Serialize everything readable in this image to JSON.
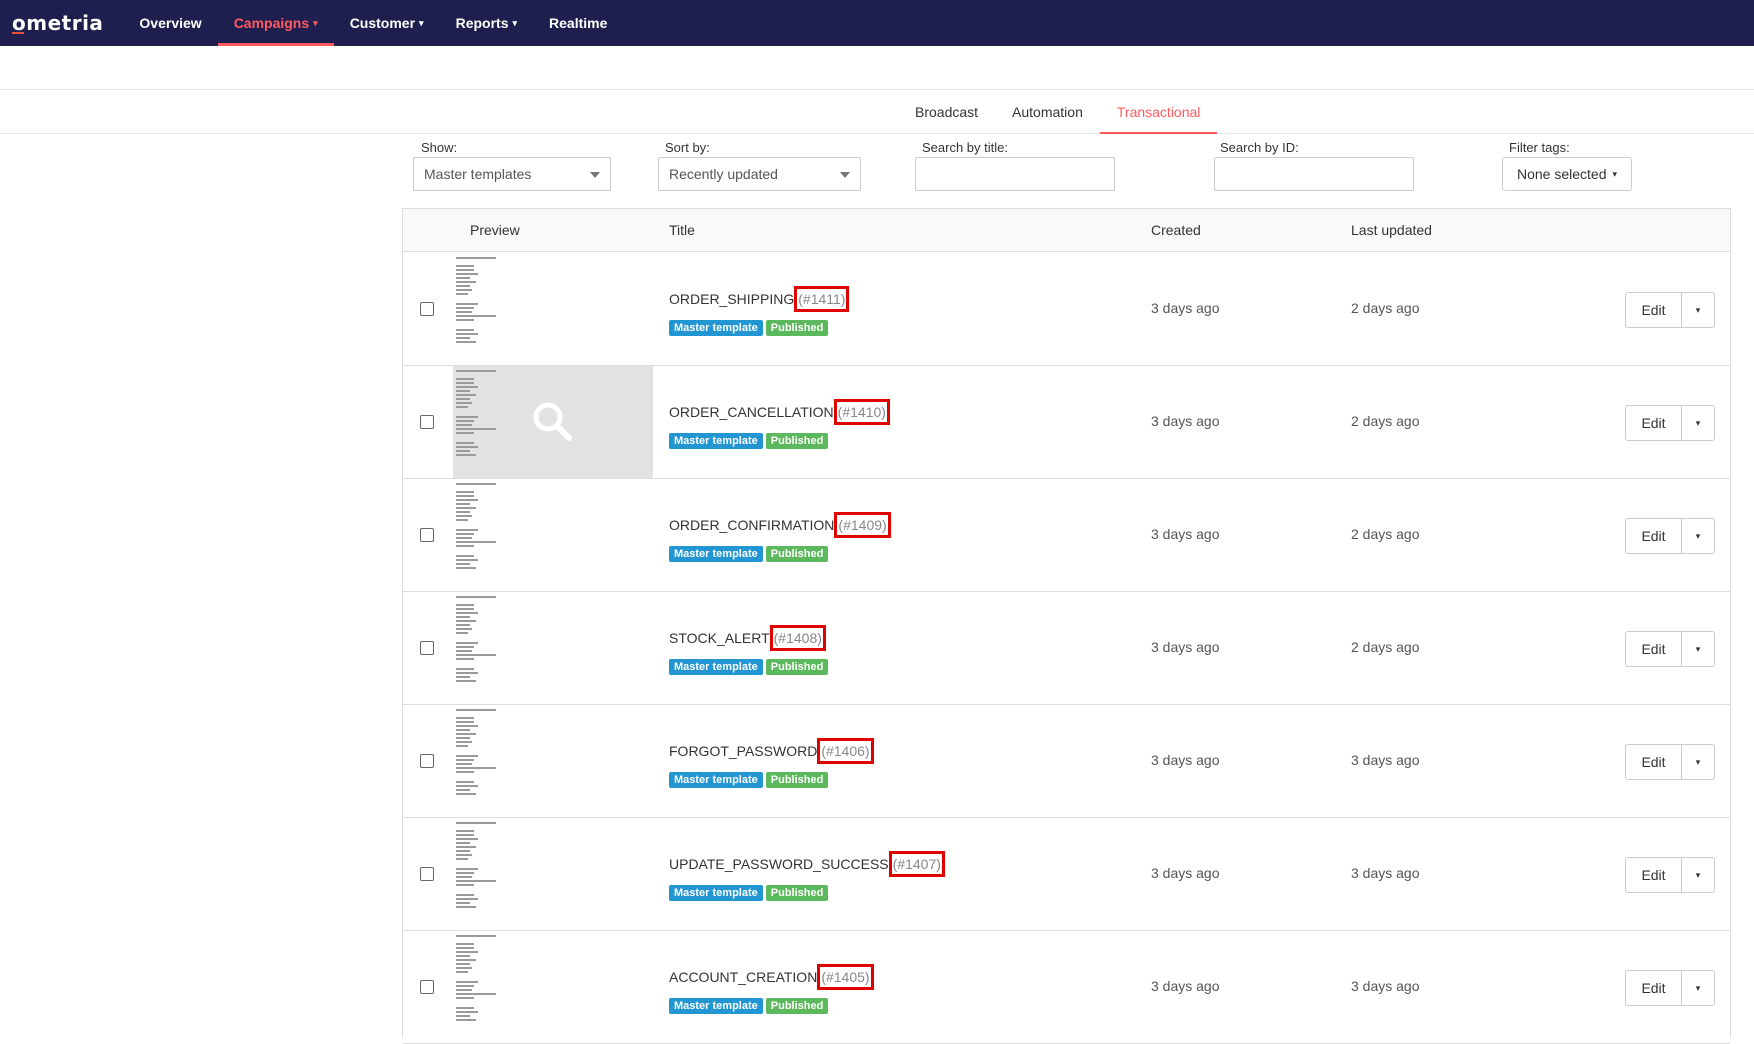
{
  "brand": {
    "logo": "ometria"
  },
  "nav": {
    "items": [
      {
        "label": "Overview",
        "active": false,
        "caret": ""
      },
      {
        "label": "Campaigns",
        "active": true,
        "caret": "▾"
      },
      {
        "label": "Customer",
        "active": false,
        "caret": "▾"
      },
      {
        "label": "Reports",
        "active": false,
        "caret": "▾"
      },
      {
        "label": "Realtime",
        "active": false,
        "caret": ""
      }
    ]
  },
  "subtabs": [
    {
      "label": "Broadcast",
      "active": false
    },
    {
      "label": "Automation",
      "active": false
    },
    {
      "label": "Transactional",
      "active": true
    }
  ],
  "filters": {
    "show_label": "Show:",
    "show_value": "Master templates",
    "sort_label": "Sort by:",
    "sort_value": "Recently updated",
    "search_title_label": "Search by title:",
    "search_title_value": "",
    "search_id_label": "Search by ID:",
    "search_id_value": "",
    "tags_label": "Filter tags:",
    "tags_value": "None selected",
    "tags_caret": "▾"
  },
  "table": {
    "headers": {
      "preview": "Preview",
      "title": "Title",
      "created": "Created",
      "updated": "Last updated"
    },
    "badge_master": "Master template",
    "badge_published": "Published",
    "edit_label": "Edit",
    "edit_caret": "▾",
    "rows": [
      {
        "title": "ORDER_SHIPPING",
        "id": "(#1411)",
        "created": "3 days ago",
        "updated": "2 days ago"
      },
      {
        "title": "ORDER_CANCELLATION",
        "id": "(#1410)",
        "created": "3 days ago",
        "updated": "2 days ago"
      },
      {
        "title": "ORDER_CONFIRMATION",
        "id": "(#1409)",
        "created": "3 days ago",
        "updated": "2 days ago"
      },
      {
        "title": "STOCK_ALERT",
        "id": "(#1408)",
        "created": "3 days ago",
        "updated": "2 days ago"
      },
      {
        "title": "FORGOT_PASSWORD",
        "id": "(#1406)",
        "created": "3 days ago",
        "updated": "3 days ago"
      },
      {
        "title": "UPDATE_PASSWORD_SUCCESS",
        "id": "(#1407)",
        "created": "3 days ago",
        "updated": "3 days ago"
      },
      {
        "title": "ACCOUNT_CREATION",
        "id": "(#1405)",
        "created": "3 days ago",
        "updated": "3 days ago"
      }
    ]
  },
  "colors": {
    "nav_bg": "#1f1f4f",
    "accent": "#ff5a5f",
    "badge_blue": "#2196d3",
    "badge_green": "#5cb85c",
    "highlight": "#e00000"
  }
}
